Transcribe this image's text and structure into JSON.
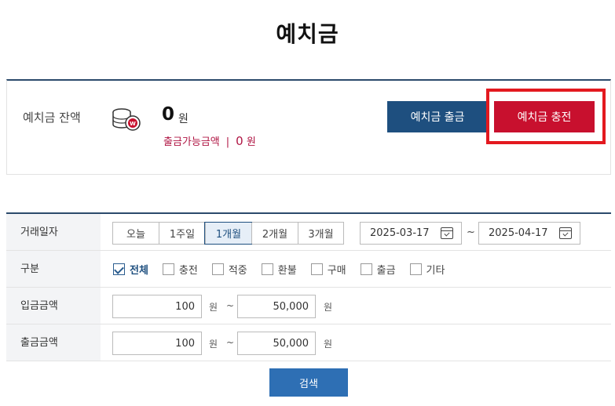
{
  "page": {
    "title": "예치금"
  },
  "balance": {
    "label": "예치금 잔액",
    "amount": "0",
    "unit": "원",
    "withdrawable_label": "출금가능금액",
    "separator": "|",
    "withdrawable_amount": "0",
    "withdrawable_unit": "원",
    "withdraw_button": "예치금 출금",
    "charge_button": "예치금 충전",
    "accent_color": "#c8102e",
    "highlight_color": "#e3191f"
  },
  "filter": {
    "period": {
      "label": "거래일자",
      "options": [
        "오늘",
        "1주일",
        "1개월",
        "2개월",
        "3개월"
      ],
      "selected": "1개월",
      "start_date": "2025-03-17",
      "end_date": "2025-04-17",
      "range_sep": "~"
    },
    "category": {
      "label": "구분",
      "options": [
        {
          "label": "전체",
          "checked": true
        },
        {
          "label": "충전",
          "checked": false
        },
        {
          "label": "적중",
          "checked": false
        },
        {
          "label": "환불",
          "checked": false
        },
        {
          "label": "구매",
          "checked": false
        },
        {
          "label": "출금",
          "checked": false
        },
        {
          "label": "기타",
          "checked": false
        }
      ]
    },
    "deposit": {
      "label": "입금금액",
      "min": "100",
      "max": "50,000",
      "unit": "원",
      "range_sep": "~"
    },
    "withdraw": {
      "label": "출금금액",
      "min": "100",
      "max": "50,000",
      "unit": "원",
      "range_sep": "~"
    },
    "search_button": "검색"
  }
}
